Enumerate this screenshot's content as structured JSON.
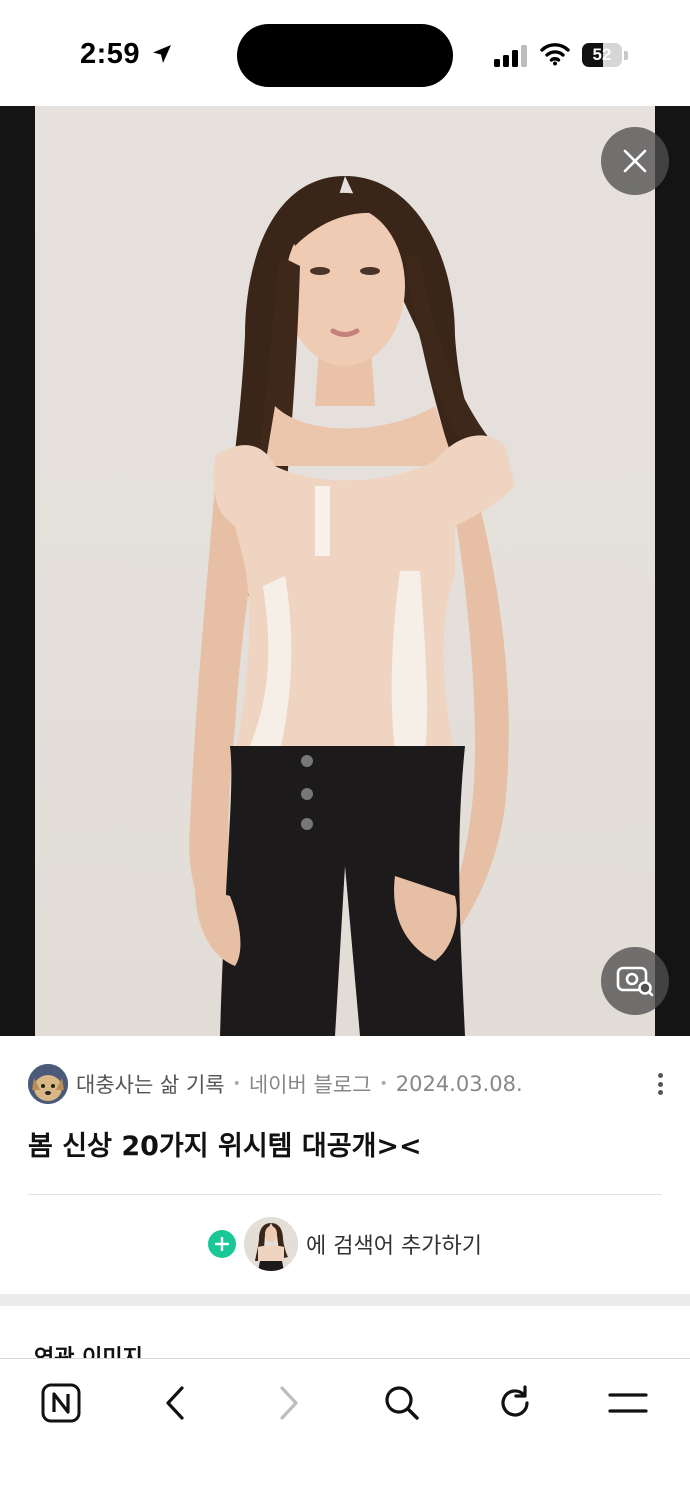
{
  "status_bar": {
    "time": "2:59",
    "battery_text": "52",
    "battery_level": 0.52,
    "icons": [
      "location-arrow-icon",
      "cellular-signal-icon",
      "wifi-icon",
      "battery-icon"
    ]
  },
  "viewer": {
    "close_icon": "close-icon",
    "lens_icon": "image-search-icon"
  },
  "info": {
    "source_name": "대충사는 삶 기록",
    "separator": "•",
    "source_site": "네이버 블로그",
    "source_date": "2024.03.08.",
    "title": "봄 신상 20가지 위시템 대공개><",
    "add_search_label": "에 검색어 추가하기"
  },
  "related": {
    "title": "연관 이미지"
  },
  "toolbar": {
    "items": [
      "naver-home-icon",
      "back-icon",
      "forward-icon",
      "search-icon",
      "reload-icon",
      "menu-icon"
    ]
  },
  "colors": {
    "accent_green": "#19c896",
    "viewer_bg": "#141414",
    "button_overlay": "#505050"
  }
}
